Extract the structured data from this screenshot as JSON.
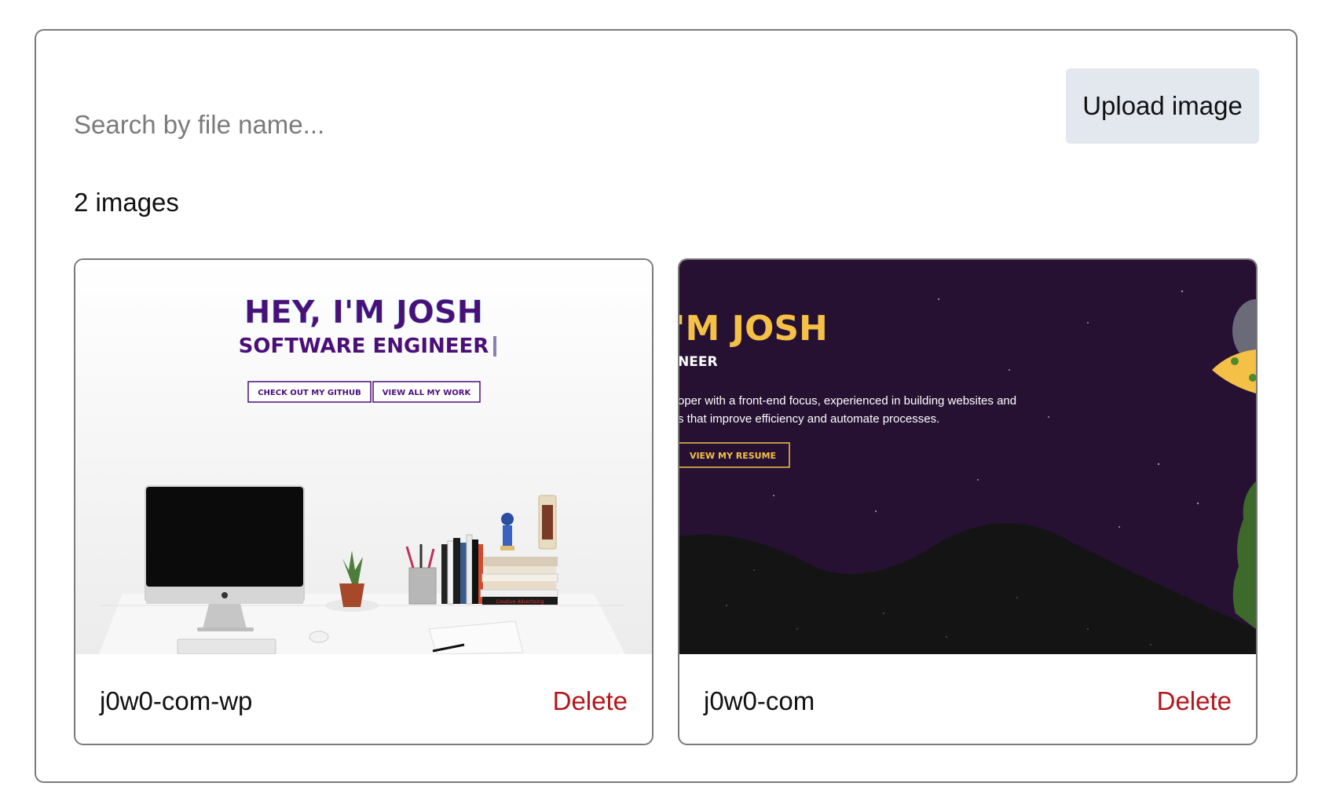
{
  "search": {
    "placeholder": "Search by file name...",
    "value": ""
  },
  "toolbar": {
    "upload_label": "Upload image"
  },
  "gallery": {
    "count_label": "2 images",
    "delete_label": "Delete",
    "images": [
      {
        "name": "j0w0-com-wp",
        "thumbnail": {
          "headline": "HEY, I'M JOSH",
          "subheadline": "SOFTWARE ENGINEER",
          "buttons": [
            "CHECK OUT MY GITHUB",
            "VIEW ALL MY WORK"
          ],
          "book_title": "Creative Advertising"
        }
      },
      {
        "name": "j0w0-com",
        "thumbnail": {
          "headline": "'M JOSH",
          "subheadline": "NEER",
          "line1": "oper with a front-end focus, experienced in building websites and",
          "line2": "s that improve efficiency and automate processes.",
          "button": "VIEW MY RESUME"
        }
      }
    ]
  },
  "colors": {
    "accent_purple": "#4b0f78",
    "dark_bg": "#261133",
    "gold": "#f4c046",
    "delete_red": "#b4161b",
    "button_bg": "#e3e7ee"
  }
}
